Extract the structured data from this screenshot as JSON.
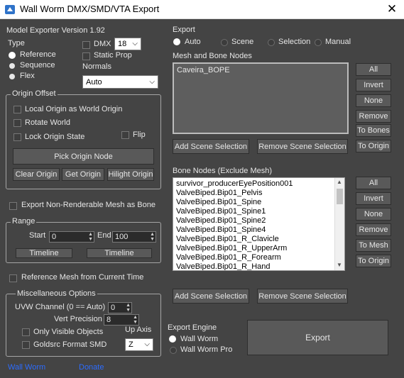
{
  "window": {
    "title": "Wall Worm DMX/SMD/VTA Export",
    "close_glyph": "✕"
  },
  "left": {
    "version": "Model Exporter Version 1.92",
    "type_label": "Type",
    "type_options": [
      "Reference",
      "Sequence",
      "Flex"
    ],
    "dmx_label": "DMX",
    "dmx_version": "18",
    "static_prop_label": "Static Prop",
    "normals_label": "Normals",
    "normals_value": "Auto",
    "origin_offset": {
      "title": "Origin Offset",
      "local_origin": "Local Origin as World Origin",
      "rotate_world": "Rotate World",
      "lock_origin": "Lock Origin State",
      "flip": "Flip",
      "pick_origin": "Pick Origin Node",
      "clear_origin": "Clear Origin",
      "get_origin": "Get Origin",
      "hilight_origin": "Hilight Origin"
    },
    "export_non_renderable": "Export Non-Renderable Mesh as Bone",
    "range": {
      "title": "Range",
      "start_label": "Start",
      "start_value": "0",
      "end_label": "End",
      "end_value": "100",
      "timeline1": "Timeline",
      "timeline2": "Timeline"
    },
    "reference_mesh": "Reference Mesh from Current Time",
    "misc": {
      "title": "Miscellaneous Options",
      "uvw_label": "UVW Channel (0 == Auto)",
      "uvw_value": "0",
      "vert_label": "Vert Precision",
      "vert_value": "8",
      "only_visible": "Only Visible Objects",
      "up_axis_label": "Up Axis",
      "goldsrc": "Goldsrc Format SMD",
      "up_axis_value": "Z"
    },
    "links": {
      "wall_worm": "Wall Worm",
      "donate": "Donate"
    }
  },
  "right": {
    "export_label": "Export",
    "export_options": [
      "Auto",
      "Scene",
      "Selection",
      "Manual"
    ],
    "mesh_bone_label": "Mesh and Bone Nodes",
    "mesh_items": [
      "Caveira_BOPE"
    ],
    "mesh_buttons": [
      "All",
      "Invert",
      "None",
      "Remove",
      "To Bones",
      "To Origin"
    ],
    "add_scene_selection": "Add Scene Selection",
    "remove_scene_selection": "Remove Scene Selection",
    "bone_nodes_label": "Bone Nodes (Exclude Mesh)",
    "bone_items": [
      "survivor_producerEyePosition001",
      "ValveBiped.Bip01_Pelvis",
      "ValveBiped.Bip01_Spine",
      "ValveBiped.Bip01_Spine1",
      "ValveBiped.Bip01_Spine2",
      "ValveBiped.Bip01_Spine4",
      "ValveBiped.Bip01_R_Clavicle",
      "ValveBiped.Bip01_R_UpperArm",
      "ValveBiped.Bip01_R_Forearm",
      "ValveBiped.Bip01_R_Hand"
    ],
    "bone_buttons": [
      "All",
      "Invert",
      "None",
      "Remove",
      "To Mesh",
      "To Origin"
    ],
    "add_scene_selection2": "Add Scene Selection",
    "remove_scene_selection2": "Remove Scene Selection",
    "export_engine_label": "Export Engine",
    "engine_options": [
      "Wall Worm",
      "Wall Worm Pro"
    ],
    "export_button": "Export"
  }
}
